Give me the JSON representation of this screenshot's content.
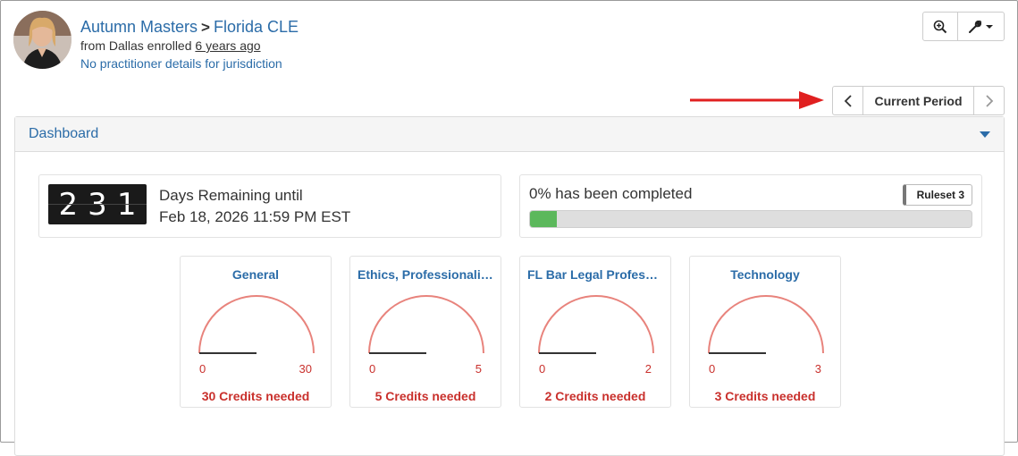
{
  "header": {
    "user_name": "Autumn Masters",
    "separator": ">",
    "jurisdiction": "Florida CLE",
    "enrolled_prefix": "from Dallas enrolled ",
    "enrolled_ago": "6 years ago",
    "practitioner_link": "No practitioner details for jurisdiction"
  },
  "toolbar": {
    "zoom_icon": "zoom-in-icon",
    "wrench_icon": "wrench-dropdown-icon"
  },
  "period": {
    "label": "Current Period",
    "prev_icon": "chevron-left-icon",
    "next_icon": "chevron-right-icon"
  },
  "annotation_arrow_color": "#e02020",
  "dashboard": {
    "title": "Dashboard",
    "days": {
      "digits": [
        "2",
        "3",
        "1"
      ],
      "label": "Days Remaining until",
      "date": "Feb 18, 2026 11:59 PM EST"
    },
    "progress": {
      "text": "0% has been completed",
      "ruleset": "Ruleset 3",
      "fill_fraction": 0.06,
      "fill_color": "#5cb85c"
    },
    "gauges": [
      {
        "title": "General",
        "min": "0",
        "max": "30",
        "needed": "30 Credits needed",
        "value_fraction": 0
      },
      {
        "title": "Ethics, Professionalis...",
        "min": "0",
        "max": "5",
        "needed": "5 Credits needed",
        "value_fraction": 0
      },
      {
        "title": "FL Bar Legal Professi...",
        "min": "0",
        "max": "2",
        "needed": "2 Credits needed",
        "value_fraction": 0
      },
      {
        "title": "Technology",
        "min": "0",
        "max": "3",
        "needed": "3 Credits needed",
        "value_fraction": 0
      }
    ]
  },
  "colors": {
    "link": "#2b6ca8",
    "needed": "#c9302c",
    "gauge_arc": "#e8837c"
  }
}
